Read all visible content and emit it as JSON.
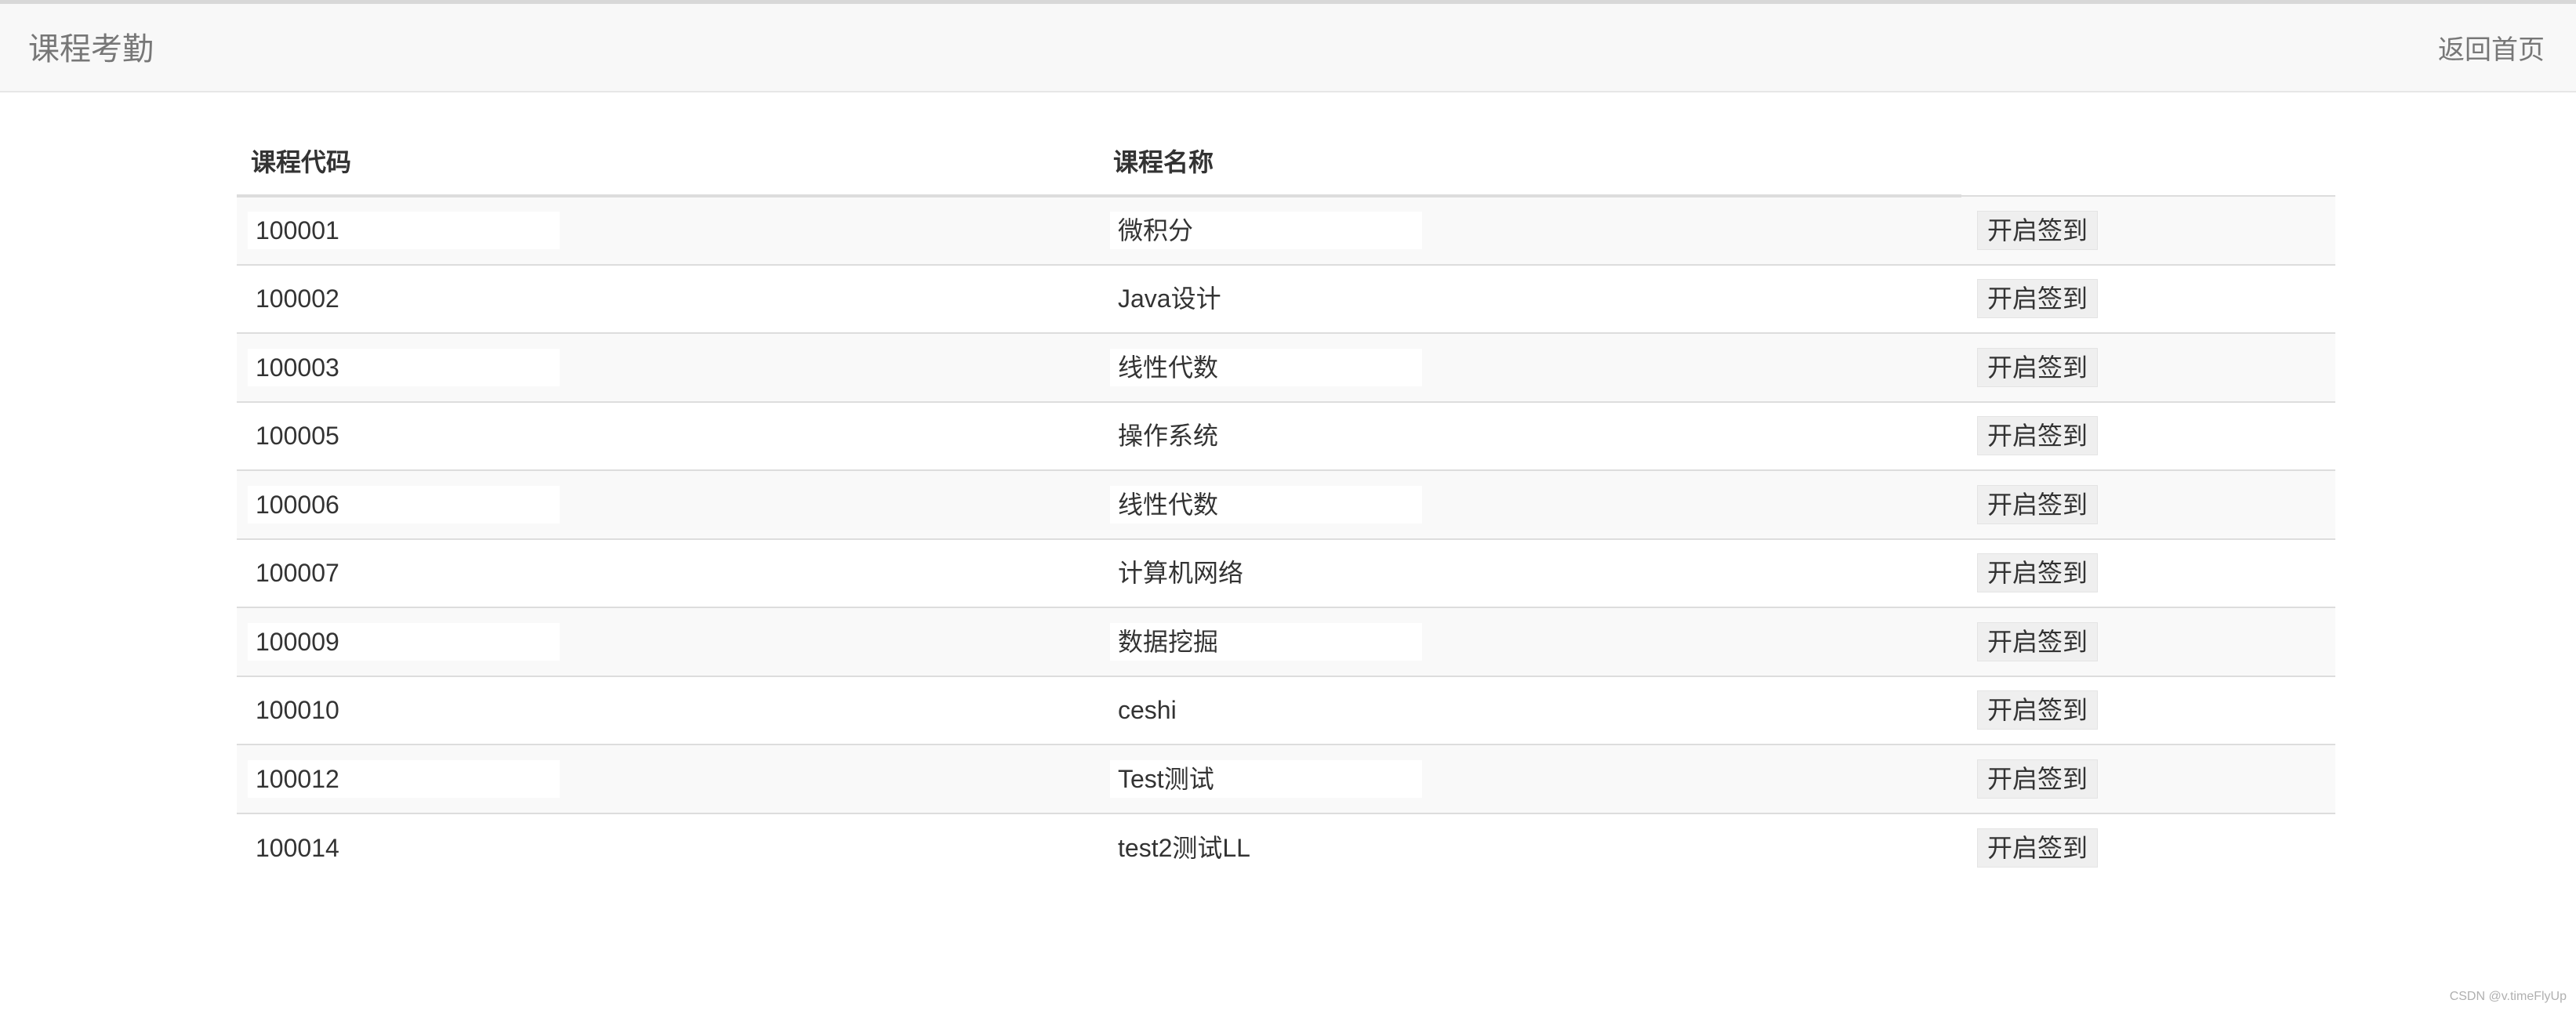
{
  "navbar": {
    "brand": "课程考勤",
    "home_link": "返回首页"
  },
  "table": {
    "headers": [
      "课程代码",
      "课程名称"
    ],
    "action_label": "开启签到",
    "rows": [
      {
        "code": "100001",
        "name": "微积分"
      },
      {
        "code": "100002",
        "name": "Java设计"
      },
      {
        "code": "100003",
        "name": "线性代数"
      },
      {
        "code": "100005",
        "name": "操作系统"
      },
      {
        "code": "100006",
        "name": "线性代数"
      },
      {
        "code": "100007",
        "name": "计算机网络"
      },
      {
        "code": "100009",
        "name": "数据挖掘"
      },
      {
        "code": "100010",
        "name": "ceshi"
      },
      {
        "code": "100012",
        "name": "Test测试"
      },
      {
        "code": "100014",
        "name": "test2测试LL"
      }
    ]
  },
  "watermark": "CSDN @v.timeFlyUp"
}
